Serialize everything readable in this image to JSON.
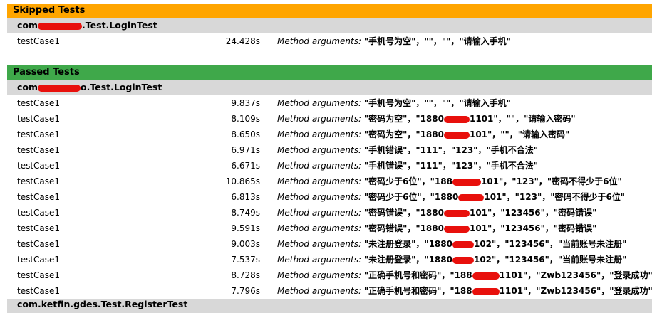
{
  "skipped": {
    "header": "Skipped Tests",
    "class_name_prefix": "com",
    "class_name_suffix": ".Test.LoginTest",
    "rows": [
      {
        "name": "testCase1",
        "duration": "24.428s",
        "args_label": "Method arguments: ",
        "args": "\"手机号为空\"，\"\"，\"\"，\"请输入手机\""
      }
    ]
  },
  "passed": {
    "header": "Passed Tests",
    "class_name_prefix": "com",
    "class_name_suffix": "o.Test.LoginTest",
    "rows": [
      {
        "name": "testCase1",
        "duration": "9.837s",
        "args_label": "Method arguments: ",
        "args_pre": "\"手机号为空\"，\"\"，\"\"，\"请输入手机\"",
        "args_post": ""
      },
      {
        "name": "testCase1",
        "duration": "8.109s",
        "args_label": "Method arguments: ",
        "args_pre": "\"密码为空\"，\"1880",
        "args_post": "1101\"，\"\"，\"请输入密码\""
      },
      {
        "name": "testCase1",
        "duration": "8.650s",
        "args_label": "Method arguments: ",
        "args_pre": "\"密码为空\"，\"1880",
        "args_post": "101\"，\"\"，\"请输入密码\""
      },
      {
        "name": "testCase1",
        "duration": "6.971s",
        "args_label": "Method arguments: ",
        "args_pre": "\"手机错误\"，\"111\"，\"123\"，\"手机不合法\"",
        "args_post": ""
      },
      {
        "name": "testCase1",
        "duration": "6.671s",
        "args_label": "Method arguments: ",
        "args_pre": "\"手机错误\"，\"111\"，\"123\"，\"手机不合法\"",
        "args_post": ""
      },
      {
        "name": "testCase1",
        "duration": "10.865s",
        "args_label": "Method arguments: ",
        "args_pre": "\"密码少于6位\"，\"188",
        "args_post": "101\"，\"123\"，\"密码不得少于6位\""
      },
      {
        "name": "testCase1",
        "duration": "6.813s",
        "args_label": "Method arguments: ",
        "args_pre": "\"密码少于6位\"，\"1880",
        "args_post": "101\"，\"123\"，\"密码不得少于6位\""
      },
      {
        "name": "testCase1",
        "duration": "8.749s",
        "args_label": "Method arguments: ",
        "args_pre": "\"密码错误\"，\"1880",
        "args_post": "101\"，\"123456\"，\"密码错误\""
      },
      {
        "name": "testCase1",
        "duration": "9.591s",
        "args_label": "Method arguments: ",
        "args_pre": "\"密码错误\"，\"1880",
        "args_post": "101\"，\"123456\"，\"密码错误\""
      },
      {
        "name": "testCase1",
        "duration": "9.003s",
        "args_label": "Method arguments: ",
        "args_pre": "\"未注册登录\"，\"1880",
        "args_post": "102\"，\"123456\"，\"当前账号未注册\""
      },
      {
        "name": "testCase1",
        "duration": "7.537s",
        "args_label": "Method arguments: ",
        "args_pre": "\"未注册登录\"，\"1880",
        "args_post": "102\"，\"123456\"，\"当前账号未注册\""
      },
      {
        "name": "testCase1",
        "duration": "8.728s",
        "args_label": "Method arguments: ",
        "args_pre": "\"正确手机号和密码\"，\"188",
        "args_post": "1101\"，\"Zwb123456\"，\"登录成功\""
      },
      {
        "name": "testCase1",
        "duration": "7.796s",
        "args_label": "Method arguments: ",
        "args_pre": "\"正确手机号和密码\"，\"188",
        "args_post": "1101\"，\"Zwb123456\"，\"登录成功\""
      }
    ]
  },
  "next_class": {
    "class_name": "com.ketfin.gdes.Test.RegisterTest"
  }
}
